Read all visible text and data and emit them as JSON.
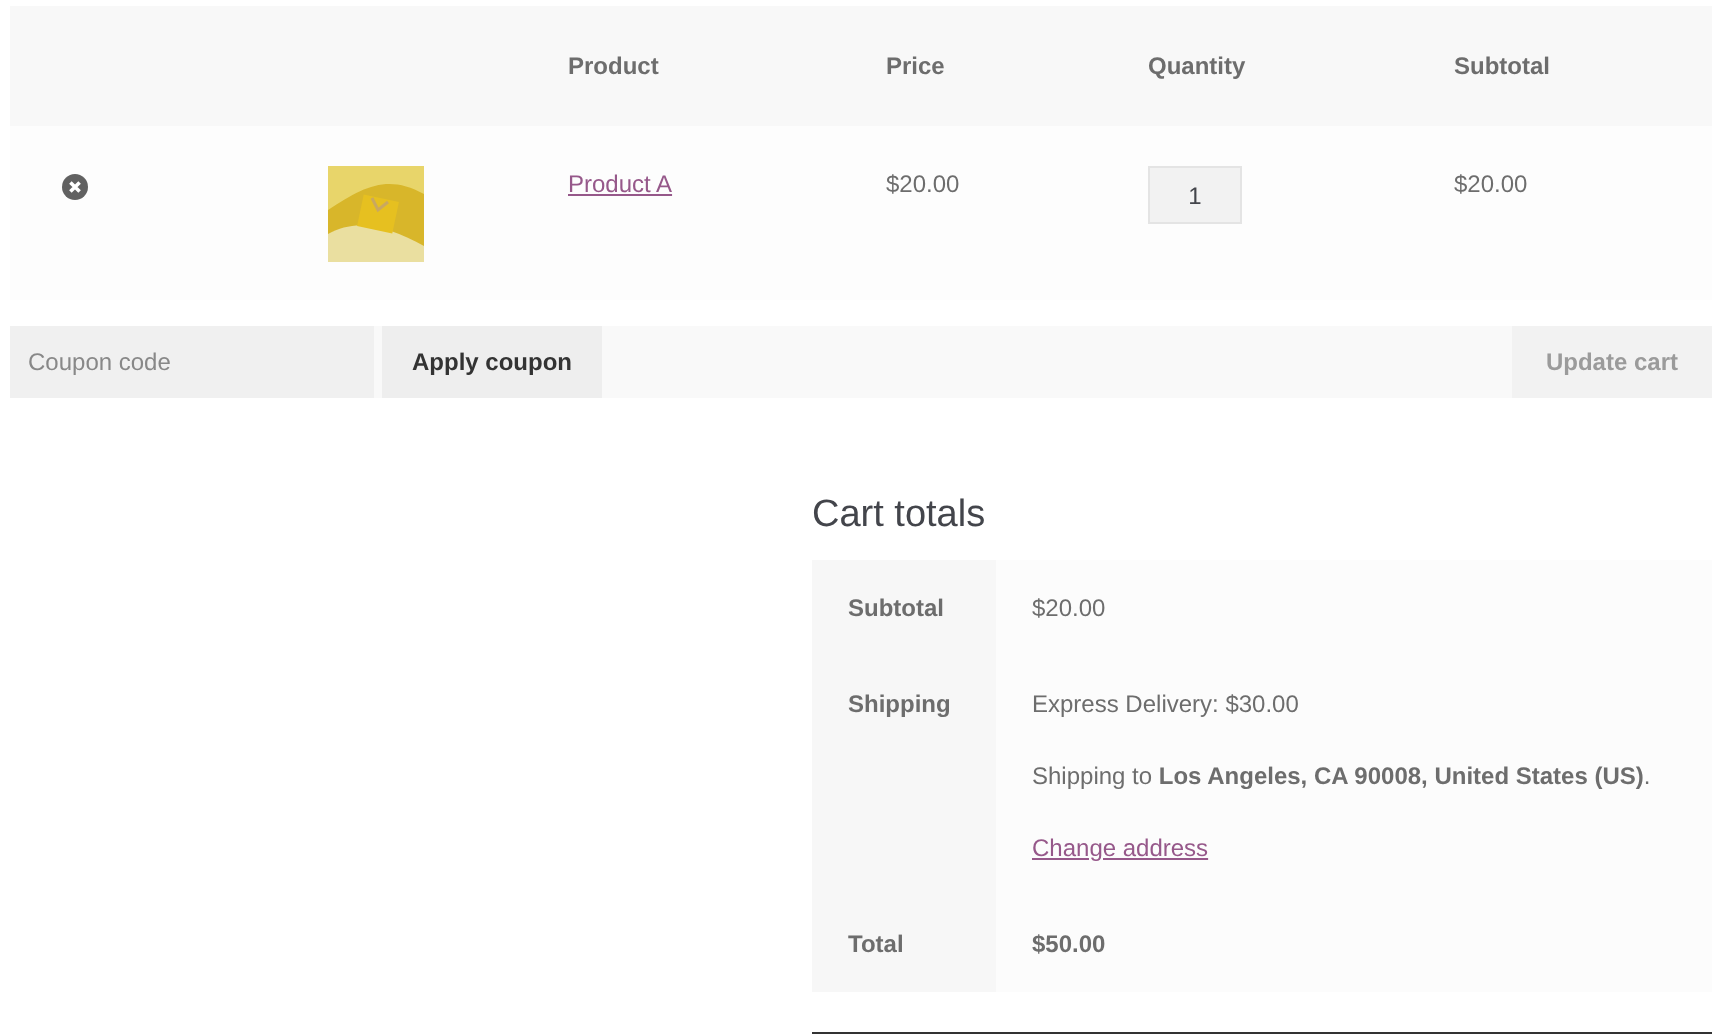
{
  "cart_table": {
    "columns": [
      "Product",
      "Price",
      "Quantity",
      "Subtotal"
    ],
    "rows": [
      {
        "product": "Product A",
        "price": "$20.00",
        "quantity": "1",
        "subtotal": "$20.00"
      }
    ]
  },
  "coupon": {
    "placeholder": "Coupon code",
    "apply_button": "Apply coupon",
    "update_button": "Update cart",
    "update_disabled": true
  },
  "cart_totals": {
    "title": "Cart totals",
    "rows": [
      {
        "kind": "plain",
        "label": "Subtotal",
        "value": "$20.00"
      },
      {
        "kind": "shipping",
        "label": "Shipping",
        "method": "Express Delivery: $30.00",
        "destination": "Shipping to **Los Angeles, CA 90008, United States (US)**.",
        "link": "Change address"
      },
      {
        "kind": "total",
        "label": "Total",
        "value": "$50.00"
      }
    ]
  }
}
